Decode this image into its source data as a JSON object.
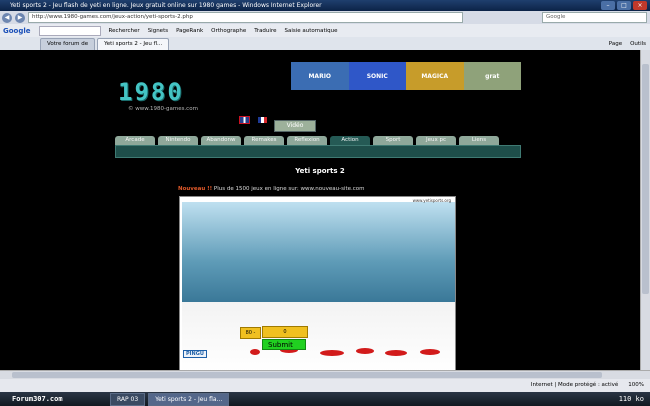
{
  "window": {
    "title": "Yeti sports 2 - Jeu flash de yeti en ligne. Jeux gratuit online sur 1980 games - Windows Internet Explorer",
    "controls": [
      "–",
      "□",
      "×"
    ]
  },
  "addressbar": {
    "url": "http://www.1980-games.com/jeux-action/yeti-sports-2.php",
    "search_placeholder": "Google"
  },
  "googlebar": {
    "logo": "Google",
    "items": [
      "Rechercher",
      "Signets",
      "PageRank",
      "Orthographe",
      "Traduire",
      "Saisie automatique"
    ]
  },
  "tabs": [
    {
      "label": "Votre forum de ",
      "active": false
    },
    {
      "label": "Yeti sports 2 - Jeu fl...",
      "active": true
    }
  ],
  "tabtools": [
    "Page",
    "Outils"
  ],
  "site": {
    "logo": "1980",
    "logo_sub": "© www.1980-games.com",
    "banner": [
      "MARIO",
      "SONIC",
      "MAGICA",
      "grat"
    ],
    "video_label": "Vidéo",
    "nav": [
      {
        "label": "Arcade",
        "active": false
      },
      {
        "label": "Nintendo",
        "active": false
      },
      {
        "label": "Abandonw",
        "active": false
      },
      {
        "label": "Remakes",
        "active": false
      },
      {
        "label": "Reflexion",
        "active": false
      },
      {
        "label": "Action",
        "active": true
      },
      {
        "label": "Sport",
        "active": false
      },
      {
        "label": "Jeux pc",
        "active": false
      },
      {
        "label": "Liens",
        "active": false
      }
    ],
    "game_title": "Yeti sports 2",
    "news_label": "Nouveau !!",
    "news_text": "Plus de 1500 jeux en ligne sur: www.nouveau-site.com"
  },
  "game": {
    "credit": "www.yetisports.org",
    "logo": "PINGU",
    "power_label": "80 -",
    "power_value": "0",
    "submit_label": "Submit"
  },
  "statusbar": {
    "left": "",
    "zone": "Internet | Mode protégé : activé",
    "zoom": "100%"
  },
  "taskbar": {
    "start": "Forum307.com",
    "tasks": [
      {
        "label": "RAP 03",
        "active": false
      },
      {
        "label": "Yeti sports 2 - Jeu fla...",
        "active": true
      }
    ],
    "tray": "110 ko"
  },
  "colors": {
    "accent": "#44c4c4",
    "nav_active": "#255a55",
    "submit": "#20d020"
  }
}
